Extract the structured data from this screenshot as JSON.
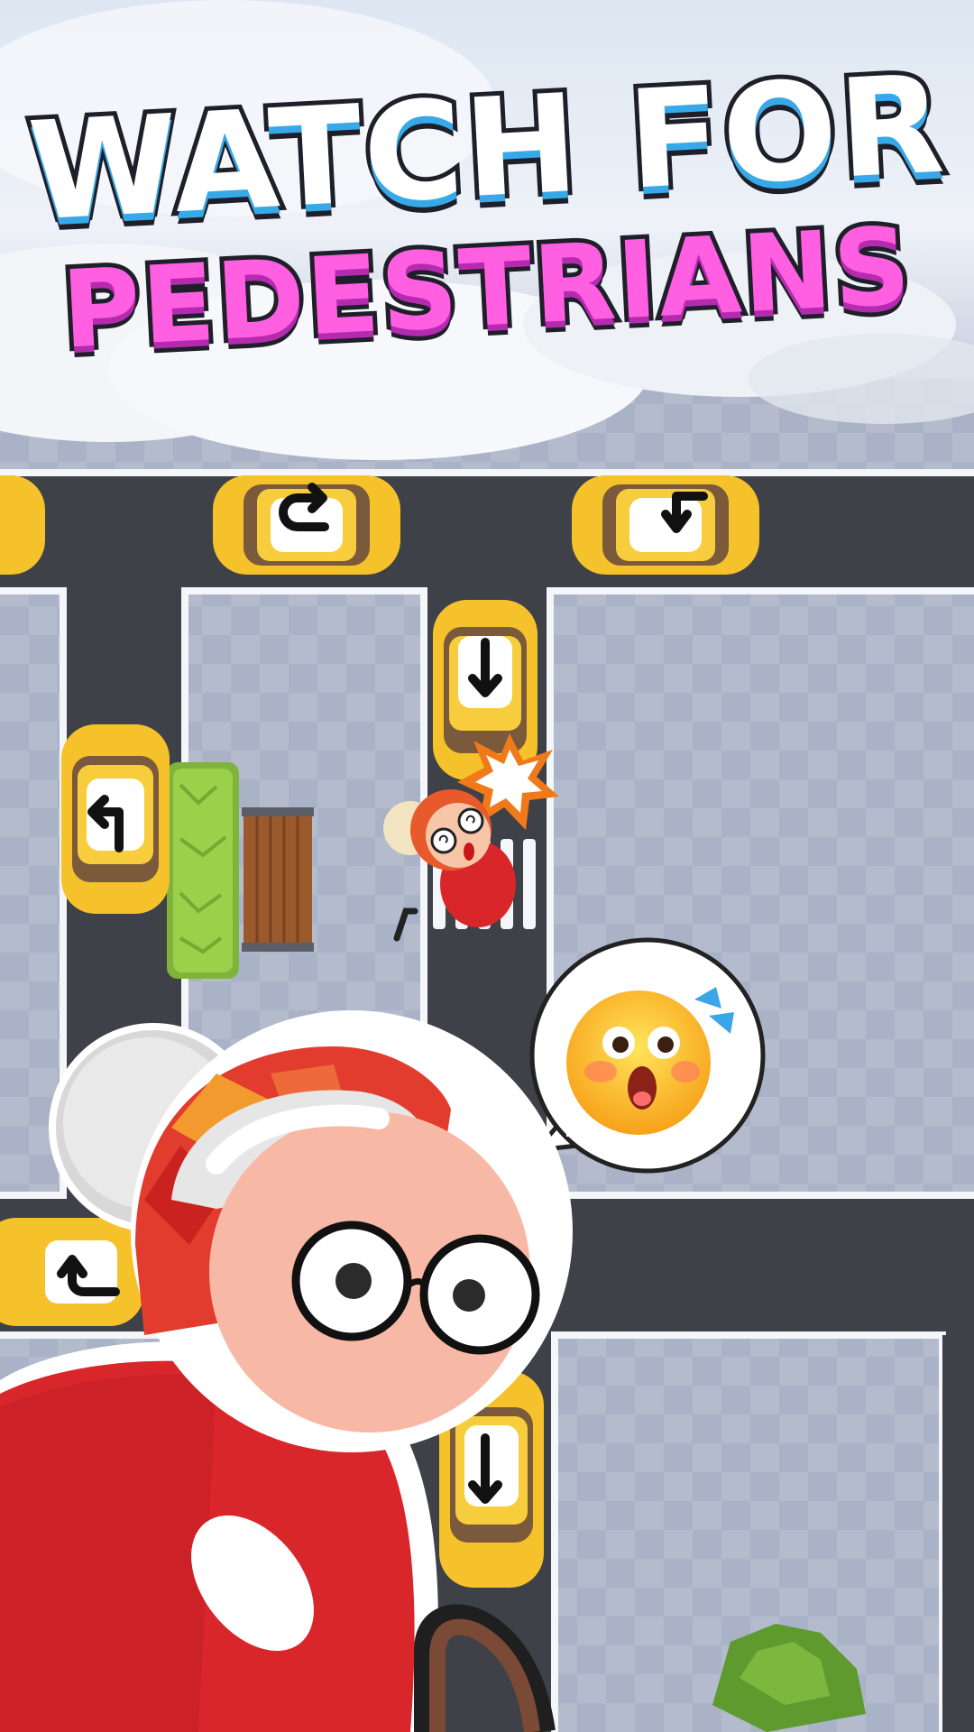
{
  "headline": {
    "line1": "WATCH FOR",
    "line2": "PEDESTRIANS"
  },
  "icons": {
    "car_arrows": [
      "u-turn-arrow-icon",
      "left-turn-arrow-icon",
      "down-arrow-icon",
      "left-turn-arrow-icon",
      "down-arrow-icon",
      "u-turn-arrow-icon"
    ],
    "collision": "collision-burst-icon",
    "emotion": "shocked-face-emoji-icon"
  },
  "colors": {
    "title_primary": "#ffffff",
    "title_primary_shadow": "#37a9e8",
    "title_secondary": "#ff5fe0",
    "taxi": "#f5c22b",
    "road": "#3e4147",
    "sidewalk": "#a9b2c6",
    "grandma_dress": "#d9262b"
  }
}
